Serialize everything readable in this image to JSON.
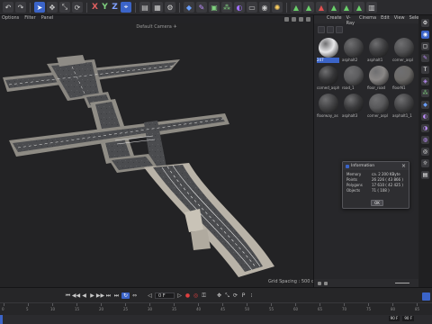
{
  "viewport": {
    "menu": [
      "Options",
      "Filter",
      "Panel"
    ],
    "camera_label": "Default Camera ✈︎",
    "grid_spacing": "Grid Spacing : 500 cm"
  },
  "material_manager": {
    "menu": [
      "Create",
      "V-Ray",
      "Cinema",
      "Edit",
      "View",
      "Select"
    ],
    "materials": [
      {
        "label": "247",
        "selected": true,
        "color": "#e8e8ea"
      },
      {
        "label": "asphalt2",
        "selected": false,
        "color": "#4a4a4c"
      },
      {
        "label": "asphalt1",
        "selected": false,
        "color": "#3e3e40"
      },
      {
        "label": "corner_aspl",
        "selected": false,
        "color": "#505052"
      },
      {
        "label": "corned_asph",
        "selected": false,
        "color": "#353537"
      },
      {
        "label": "road_1",
        "selected": false,
        "color": "#5c5c5e"
      },
      {
        "label": "floor_road",
        "selected": false,
        "color": "#8a8786"
      },
      {
        "label": "floorN1",
        "selected": false,
        "color": "#6c6a68"
      },
      {
        "label": "floorway_as",
        "selected": false,
        "color": "#434345"
      },
      {
        "label": "asphalt3",
        "selected": false,
        "color": "#3a3a3c"
      },
      {
        "label": "corner_aspl",
        "selected": false,
        "color": "#58585a"
      },
      {
        "label": "asphalt1_1",
        "selected": false,
        "color": "#454547"
      }
    ]
  },
  "info_dialog": {
    "title": "Information",
    "close": "×",
    "rows": [
      {
        "key": "Memory",
        "value": "ca. 2 200 KByte"
      },
      {
        "key": "Points",
        "value": "26 226 ( 43 866 )"
      },
      {
        "key": "Polygons",
        "value": "17 610 ( 42 425 )"
      },
      {
        "key": "Objects",
        "value": "71 ( 108 )"
      }
    ],
    "ok_label": "OK"
  },
  "timeline": {
    "frame_value": "0 F",
    "ticks": [
      "0",
      "5",
      "10",
      "15",
      "20",
      "25",
      "30",
      "35",
      "40",
      "45",
      "50",
      "55",
      "60",
      "65",
      "70",
      "75",
      "80",
      "85"
    ],
    "start_frame": "90 F",
    "end_frame": "90 F"
  },
  "colors": {
    "accent": "#3b64c8",
    "record": "#e04040",
    "background": "#232325"
  }
}
